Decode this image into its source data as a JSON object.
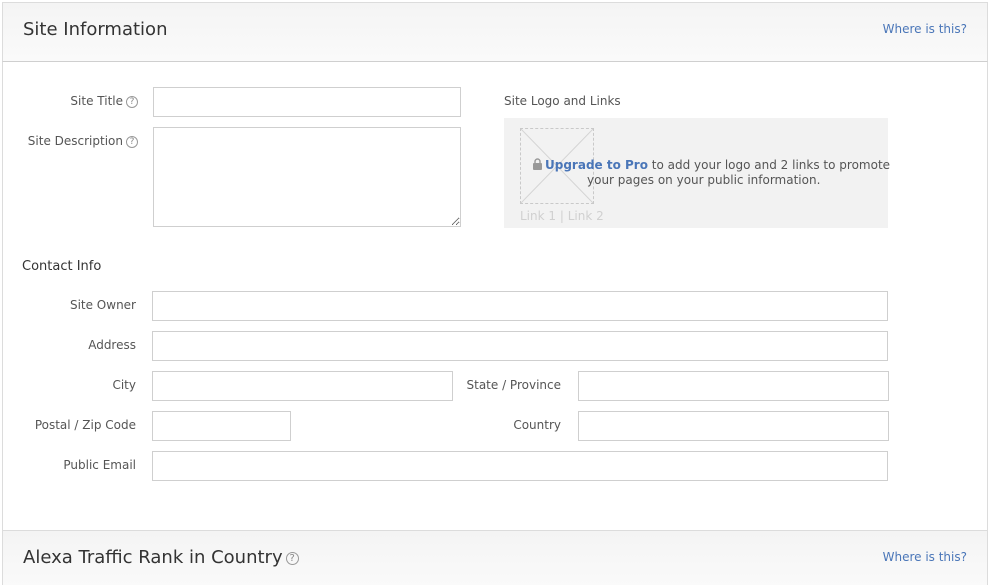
{
  "site_info": {
    "title": "Site Information",
    "where_link": "Where is this?",
    "site_title_label": "Site Title",
    "site_title_value": "",
    "site_description_label": "Site Description",
    "site_description_value": "",
    "help_icon": "?",
    "logo": {
      "label": "Site Logo and Links",
      "upgrade_link": "Upgrade to Pro",
      "promo_line1_rest": " to add your logo and 2 links to promote",
      "promo_line2": "your pages on your public information.",
      "links_placeholder": "Link 1  |  Link 2",
      "placeholder_icon": "image-placeholder-icon",
      "lock_icon": "lock-icon"
    }
  },
  "contact": {
    "heading": "Contact Info",
    "site_owner_label": "Site Owner",
    "site_owner_value": "",
    "address_label": "Address",
    "address_value": "",
    "city_label": "City",
    "city_value": "",
    "state_label": "State / Province",
    "state_value": "",
    "postal_label": "Postal / Zip Code",
    "postal_value": "",
    "country_label": "Country",
    "country_value": "",
    "email_label": "Public Email",
    "email_value": ""
  },
  "alexa": {
    "title": "Alexa Traffic Rank in Country",
    "where_link": "Where is this?",
    "help_icon": "?"
  },
  "colors": {
    "link": "#4a76b8",
    "border": "#cfcfcf",
    "header_bg": "#f4f4f4",
    "promo_bg": "#f2f2f2"
  }
}
